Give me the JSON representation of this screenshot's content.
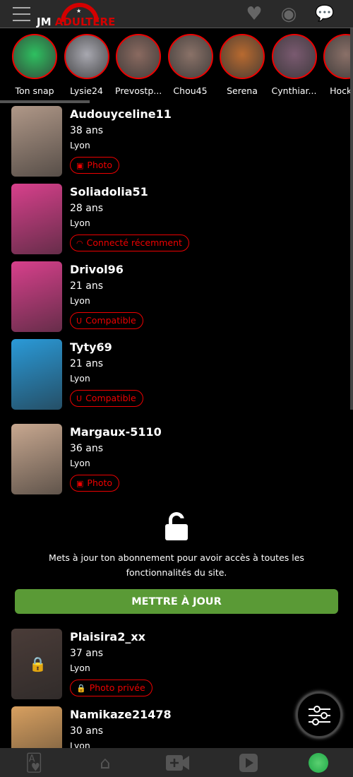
{
  "header": {
    "logo_left": "JM",
    "logo_right": "ADULTERE",
    "icons": [
      "menu-icon",
      "heart-icon",
      "eye-icon",
      "chat-icon"
    ]
  },
  "stories": [
    {
      "label": "Ton snap",
      "color": "#2ec060"
    },
    {
      "label": "Lysie24",
      "color": "#a8a8b0"
    },
    {
      "label": "Prevostp...",
      "color": "#8a6a60"
    },
    {
      "label": "Chou45",
      "color": "#8a7268"
    },
    {
      "label": "Serena",
      "color": "#b86a30"
    },
    {
      "label": "Cynthiar...",
      "color": "#7a5a70"
    },
    {
      "label": "Hockey",
      "color": "#8a7068"
    }
  ],
  "profiles": [
    {
      "name": "Audouyceline11",
      "age": "38 ans",
      "city": "Lyon",
      "badge": "Photo",
      "badge_icon": "photo-icon",
      "color": "#b09888"
    },
    {
      "name": "Soliadolia51",
      "age": "28 ans",
      "city": "Lyon",
      "badge": "Connecté récemment",
      "badge_icon": "wifi-icon",
      "color": "#d8408c"
    },
    {
      "name": "Drivol96",
      "age": "21 ans",
      "city": "Lyon",
      "badge": "Compatible",
      "badge_icon": "magnet-icon",
      "color": "#d8408c"
    },
    {
      "name": "Tyty69",
      "age": "21 ans",
      "city": "Lyon",
      "badge": "Compatible",
      "badge_icon": "magnet-icon",
      "color": "#2a9ad8"
    },
    {
      "name": "Margaux-5110",
      "age": "36 ans",
      "city": "Lyon",
      "badge": "Photo",
      "badge_icon": "photo-icon",
      "color": "#c8a890"
    }
  ],
  "upgrade": {
    "message": "Mets à jour ton abonnement pour avoir accès à toutes les fonctionnalités du site.",
    "button": "METTRE À JOUR"
  },
  "profiles_after": [
    {
      "name": "Plaisira2_xx",
      "age": "37 ans",
      "city": "Lyon",
      "badge": "Photo privée",
      "badge_icon": "lock-icon",
      "color": "#4a3c38"
    },
    {
      "name": "Namikaze21478",
      "age": "30 ans",
      "city": "Lyon",
      "color": "#d8a060"
    }
  ],
  "colors": {
    "accent": "#e00000",
    "upgrade_button": "#5a9a36",
    "header_bg": "#2a2a2a"
  }
}
